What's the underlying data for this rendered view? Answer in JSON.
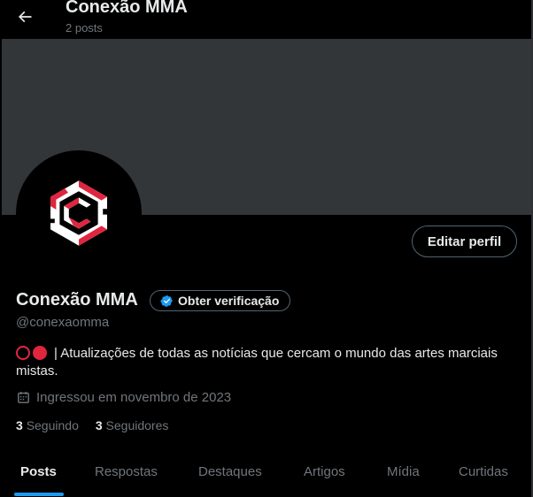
{
  "header": {
    "title": "Conexão MMA",
    "post_count": "2 posts"
  },
  "profile": {
    "name": "Conexão MMA",
    "verify_label": "Obter verificação",
    "handle": "@conexaomma",
    "bio": "| Atualizações de todas as notícias que cercam o mundo das artes marciais mistas.",
    "joined": "Ingressou em novembro de 2023",
    "edit_label": "Editar perfil",
    "following_count": "3",
    "following_label": "Seguindo",
    "followers_count": "3",
    "followers_label": "Seguidores"
  },
  "tabs": [
    {
      "label": "Posts",
      "active": true
    },
    {
      "label": "Respostas",
      "active": false
    },
    {
      "label": "Destaques",
      "active": false
    },
    {
      "label": "Artigos",
      "active": false
    },
    {
      "label": "Mídia",
      "active": false
    },
    {
      "label": "Curtidas",
      "active": false
    }
  ],
  "colors": {
    "background": "#000000",
    "banner": "#333639",
    "accent": "#1d9bf0",
    "text_primary": "#e7e9ea",
    "text_secondary": "#71767b",
    "logo_red": "#e0263f"
  },
  "icons": {
    "back": "arrow-left-icon",
    "verified": "verified-badge-icon",
    "calendar": "calendar-icon",
    "avatar_logo": "hexagon-c-logo"
  }
}
